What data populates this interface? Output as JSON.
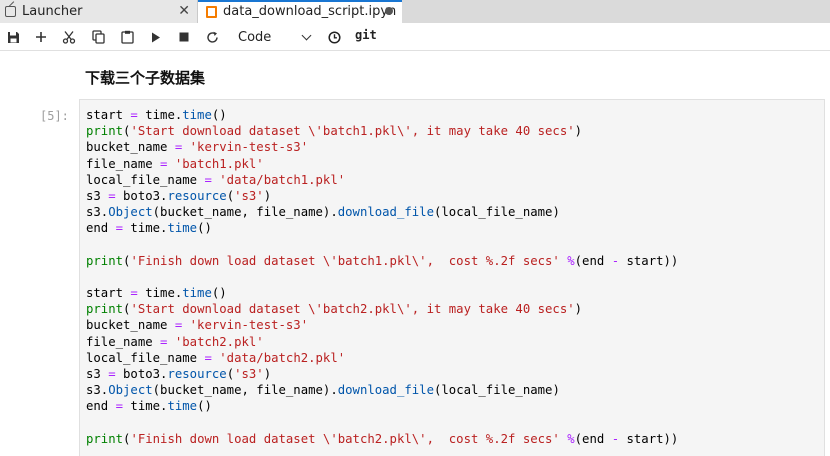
{
  "tabs": [
    {
      "label": "Launcher",
      "icon": "launcher-icon",
      "active": false,
      "close_glyph": "✕"
    },
    {
      "label": "data_download_script.ipyn",
      "icon": "notebook-icon",
      "active": true,
      "unsaved": true
    }
  ],
  "toolbar": {
    "buttons": [
      "save-icon",
      "add-cell-icon",
      "cut-icon",
      "copy-icon",
      "paste-icon",
      "run-icon",
      "stop-icon",
      "restart-icon"
    ],
    "cell_type": "Code",
    "git_label": "git"
  },
  "notebook": {
    "markdown_heading": "下载三个子数据集",
    "cell_prompt": "[5]:",
    "code_lines": [
      "start = time.time()",
      "print('Start download dataset \\'batch1.pkl\\', it may take 40 secs')",
      "bucket_name = 'kervin-test-s3'",
      "file_name = 'batch1.pkl'",
      "local_file_name = 'data/batch1.pkl'",
      "s3 = boto3.resource('s3')",
      "s3.Object(bucket_name, file_name).download_file(local_file_name)",
      "end = time.time()",
      "",
      "print('Finish down load dataset \\'batch1.pkl\\',  cost %.2f secs' %(end - start))",
      "",
      "start = time.time()",
      "print('Start download dataset \\'batch2.pkl\\', it may take 40 secs')",
      "bucket_name = 'kervin-test-s3'",
      "file_name = 'batch2.pkl'",
      "local_file_name = 'data/batch2.pkl'",
      "s3 = boto3.resource('s3')",
      "s3.Object(bucket_name, file_name).download_file(local_file_name)",
      "end = time.time()",
      "",
      "print('Finish down load dataset \\'batch2.pkl\\',  cost %.2f secs' %(end - start))"
    ]
  },
  "colors": {
    "active_tab_accent": "#1976d2",
    "notebook_icon": "#f57c00",
    "string": "#ba2121",
    "builtin": "#008000",
    "attribute": "#0055aa",
    "operator": "#aa22ff"
  }
}
